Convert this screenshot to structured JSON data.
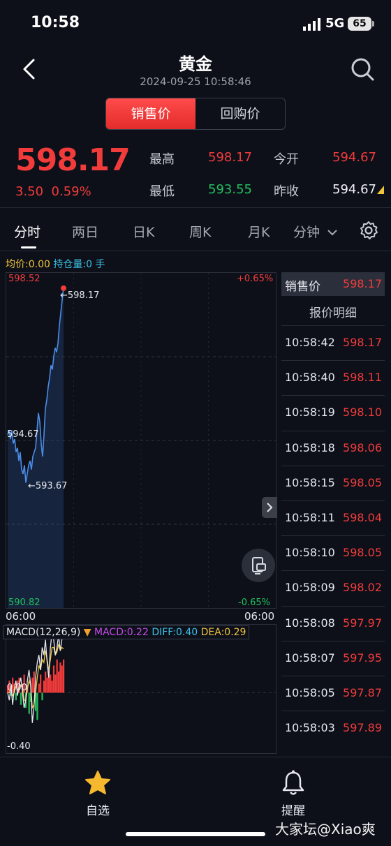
{
  "status_bar": {
    "time": "10:58",
    "network": "5G",
    "battery": "65"
  },
  "header": {
    "title": "黄金",
    "datetime": "2024-09-25 10:58:46"
  },
  "segments": {
    "active": "销售价",
    "inactive": "回购价"
  },
  "quote": {
    "price": "598.17",
    "change": "3.50",
    "change_pct": "0.59%",
    "high_label": "最高",
    "high": "598.17",
    "open_label": "今开",
    "open": "594.67",
    "low_label": "最低",
    "low": "593.55",
    "prev_close_label": "昨收",
    "prev_close": "594.67"
  },
  "tabs": [
    "分时",
    "两日",
    "日K",
    "周K",
    "月K",
    "分钟"
  ],
  "info_line": {
    "avg_label": "均价:",
    "avg_value": "0.00",
    "pos_label": "持仓量:",
    "pos_value": "0 手"
  },
  "chart_data": {
    "type": "line",
    "title": "",
    "y_top": "598.52",
    "y_bottom": "590.82",
    "pct_top": "+0.65%",
    "pct_bottom": "-0.65%",
    "prev_close_label": "594.67",
    "max_marker": "←598.17",
    "min_marker": "←593.67",
    "x_start": "06:00",
    "x_end": "06:00",
    "ylim": [
      590.82,
      598.52
    ],
    "x": [
      0,
      1,
      2,
      3,
      4,
      5,
      6,
      7,
      8,
      9,
      10,
      11,
      12,
      13,
      14,
      15,
      16,
      17,
      18,
      19,
      20,
      21,
      22,
      23,
      24,
      25,
      26,
      27,
      28,
      29,
      30,
      31,
      32,
      33,
      34,
      35,
      36,
      37,
      38,
      39,
      40
    ],
    "values": [
      594.8,
      594.9,
      594.7,
      594.9,
      594.6,
      594.7,
      594.4,
      594.5,
      594.2,
      594.4,
      594.0,
      593.9,
      594.1,
      593.7,
      593.9,
      594.1,
      594.2,
      594.0,
      594.3,
      594.4,
      594.5,
      594.9,
      595.3,
      595.1,
      594.6,
      594.3,
      594.8,
      595.4,
      595.6,
      595.9,
      596.1,
      596.4,
      596.3,
      596.6,
      596.8,
      596.7,
      596.9,
      597.3,
      597.6,
      597.9,
      598.17
    ]
  },
  "macd_data": {
    "legend_name": "MACD(12,26,9)",
    "macd_label": "MACD:0.22",
    "diff_label": "DIFF:0.40",
    "dea_label": "DEA:0.29",
    "zero_label": "0.00",
    "bottom_label": "-0.40",
    "ylim": [
      -0.4,
      0.45
    ],
    "bars": [
      0.05,
      0.08,
      -0.02,
      0.1,
      0.06,
      -0.05,
      0.08,
      0.1,
      -0.08,
      0.06,
      0.12,
      -0.1,
      0.05,
      -0.14,
      -0.06,
      0.1,
      0.14,
      -0.12,
      -0.18,
      0.06,
      0.12,
      -0.05,
      0.08,
      0.14,
      0.1,
      0.16,
      0.12,
      0.08,
      0.18,
      0.12,
      0.22,
      0.14,
      0.2,
      0.18,
      0.22
    ],
    "diff": [
      0.0,
      -0.05,
      0.05,
      -0.08,
      0.02,
      0.08,
      -0.02,
      0.05,
      0.1,
      0.0,
      -0.1,
      -0.05,
      0.08,
      0.15,
      0.05,
      -0.2,
      -0.1,
      0.1,
      0.2,
      0.25,
      0.15,
      0.3,
      0.25,
      0.35,
      0.2,
      0.1,
      0.3,
      0.4,
      0.35,
      0.25,
      0.3,
      0.38,
      0.28,
      0.35,
      0.4
    ],
    "dea": [
      0.0,
      0.0,
      0.02,
      -0.02,
      0.0,
      0.04,
      0.02,
      0.02,
      0.05,
      0.03,
      -0.05,
      -0.05,
      0.02,
      0.08,
      0.05,
      -0.1,
      -0.08,
      0.0,
      0.1,
      0.18,
      0.15,
      0.22,
      0.2,
      0.28,
      0.22,
      0.15,
      0.22,
      0.3,
      0.3,
      0.25,
      0.27,
      0.32,
      0.28,
      0.3,
      0.29
    ]
  },
  "right_panel": {
    "head_label": "销售价",
    "head_value": "598.17",
    "title": "报价明细",
    "rows": [
      {
        "time": "10:58:42",
        "price": "598.17"
      },
      {
        "time": "10:58:40",
        "price": "598.11"
      },
      {
        "time": "10:58:19",
        "price": "598.10"
      },
      {
        "time": "10:58:18",
        "price": "598.06"
      },
      {
        "time": "10:58:15",
        "price": "598.05"
      },
      {
        "time": "10:58:11",
        "price": "598.04"
      },
      {
        "time": "10:58:10",
        "price": "598.05"
      },
      {
        "time": "10:58:09",
        "price": "598.02"
      },
      {
        "time": "10:58:08",
        "price": "597.97"
      },
      {
        "time": "10:58:07",
        "price": "597.95"
      },
      {
        "time": "10:58:05",
        "price": "597.87"
      },
      {
        "time": "10:58:03",
        "price": "597.89"
      }
    ]
  },
  "bottom_nav": {
    "watchlist": "自选",
    "alert": "提醒"
  },
  "watermark": "大家坛@Xiao爽",
  "colors": {
    "up": "#f23b3b",
    "down": "#22c05c",
    "line": "#4a8de8",
    "bg": "#0d1019"
  }
}
